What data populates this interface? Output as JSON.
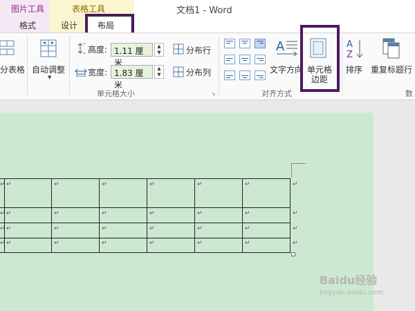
{
  "window": {
    "title": "文档1 - Word"
  },
  "context_tabs": {
    "picture_tools": "图片工具",
    "table_tools": "表格工具"
  },
  "tabs": [
    {
      "label": "格式"
    },
    {
      "label": "设计"
    },
    {
      "label": "布局"
    }
  ],
  "ribbon": {
    "split_table": "分表格",
    "autofit": "自动调整",
    "height_label": "高度:",
    "height_value": "1.11 厘米",
    "width_label": "宽度:",
    "width_value": "1.83 厘米",
    "distribute_rows": "分布行",
    "distribute_cols": "分布列",
    "cell_size_group": "单元格大小",
    "text_direction": "文字方向",
    "cell_margins_line1": "单元格",
    "cell_margins_line2": "边距",
    "sort": "排序",
    "repeat_header": "重复标题行",
    "alignment_group": "对齐方式",
    "data_group_partial": "数"
  },
  "paragraph_mark": "↵",
  "watermark": {
    "brand": "Baidu经验",
    "url": "jingyan.baidu.com"
  }
}
